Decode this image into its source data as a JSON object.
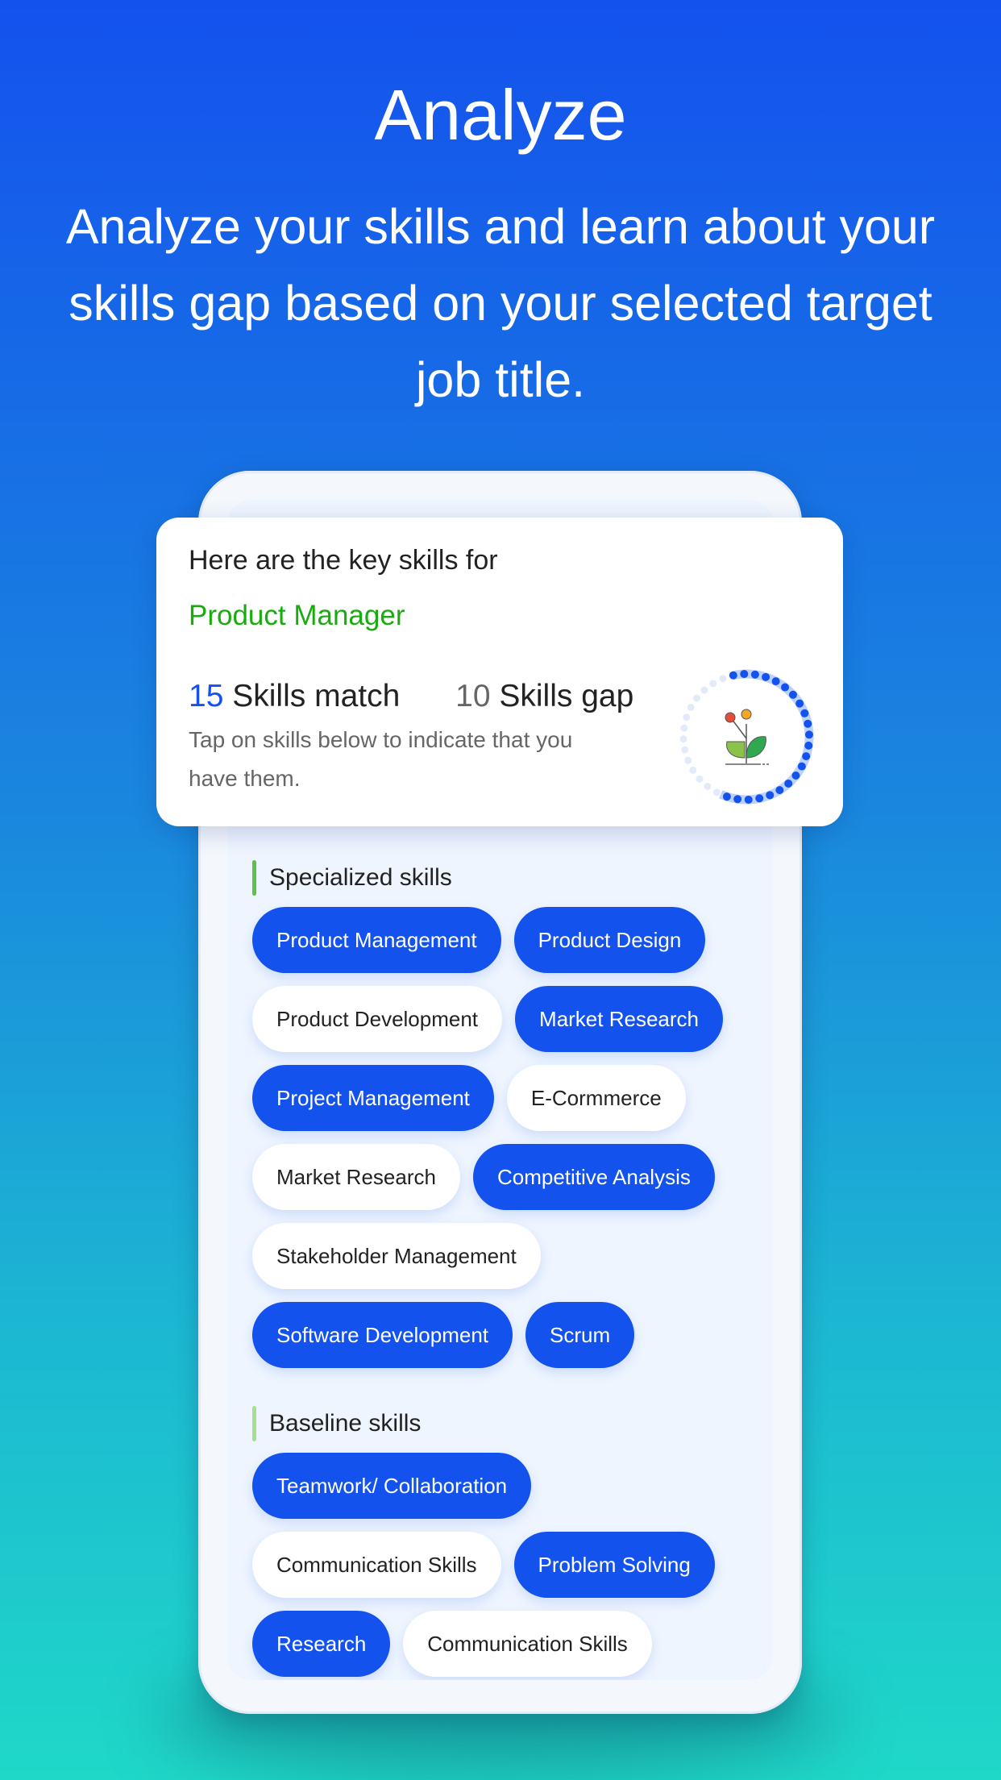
{
  "hero": {
    "title": "Analyze",
    "subtitle": "Analyze your skills and learn about your skills gap based on your selected target job title."
  },
  "card": {
    "heading": "Here are the key skills for",
    "job_title": "Product Manager",
    "match_count": "15",
    "match_label": "Skills match",
    "gap_count": "10",
    "gap_label": "Skills gap",
    "hint": "Tap on skills below to indicate that you have them.",
    "progress_fraction": 0.6,
    "icon": "plant-icon"
  },
  "colors": {
    "accent": "#1452ee",
    "job_title": "#1aab10",
    "section_bar_specialized": "#5cc24a",
    "section_bar_baseline": "#a6e08e"
  },
  "specialized": {
    "label": "Specialized skills",
    "rows": [
      [
        {
          "label": "Product Management",
          "selected": true
        },
        {
          "label": "Product Design",
          "selected": true
        }
      ],
      [
        {
          "label": "Product Development",
          "selected": false
        },
        {
          "label": "Market Research",
          "selected": true
        }
      ],
      [
        {
          "label": "Project Management",
          "selected": true
        },
        {
          "label": "E-Cormmerce",
          "selected": false
        }
      ],
      [
        {
          "label": "Market Research",
          "selected": false
        },
        {
          "label": "Competitive Analysis",
          "selected": true
        }
      ],
      [
        {
          "label": "Stakeholder Management",
          "selected": false
        }
      ],
      [
        {
          "label": "Software Development",
          "selected": true
        },
        {
          "label": "Scrum",
          "selected": true
        }
      ]
    ]
  },
  "baseline": {
    "label": "Baseline skills",
    "rows": [
      [
        {
          "label": "Teamwork/ Collaboration",
          "selected": true
        }
      ],
      [
        {
          "label": "Communication Skills",
          "selected": false
        },
        {
          "label": "Problem Solving",
          "selected": true
        }
      ],
      [
        {
          "label": "Research",
          "selected": true
        },
        {
          "label": "Communication Skills",
          "selected": false
        }
      ]
    ]
  }
}
